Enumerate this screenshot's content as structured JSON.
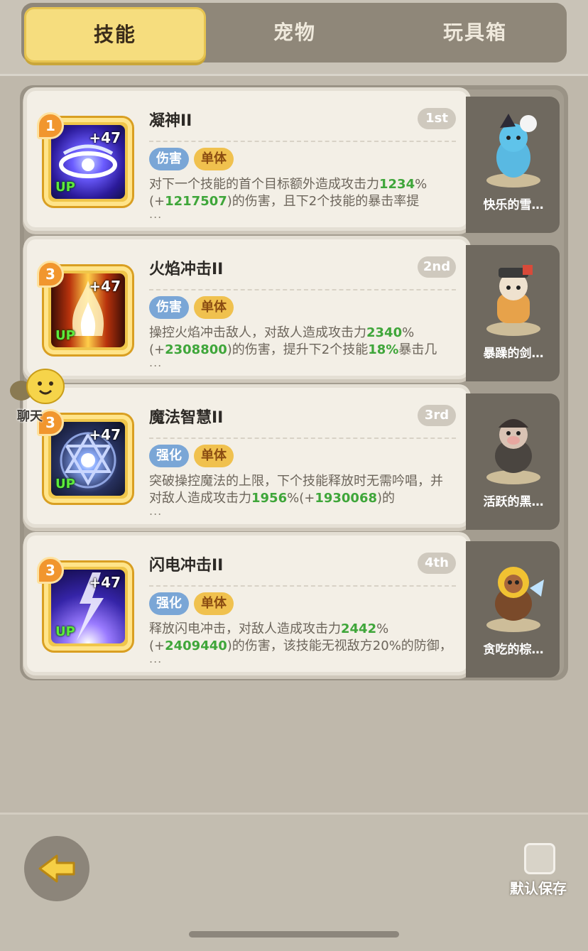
{
  "tabs": [
    {
      "label": "技能",
      "active": true
    },
    {
      "label": "宠物",
      "active": false
    },
    {
      "label": "玩具箱",
      "active": false
    }
  ],
  "skills": [
    {
      "level": "1",
      "plus": "+47",
      "up": "UP",
      "name": "凝神II",
      "rank": "1st",
      "tags": [
        "伤害",
        "单体"
      ],
      "desc_parts": [
        "对下一个技能的首个目标额外造成攻击力",
        "1234",
        "%(+",
        "1217507",
        ")的伤害，且下2个技能的暴击率提"
      ],
      "ellipsis": "...",
      "pet": "快乐的雪…"
    },
    {
      "level": "3",
      "plus": "+47",
      "up": "UP",
      "name": "火焰冲击II",
      "rank": "2nd",
      "tags": [
        "伤害",
        "单体"
      ],
      "desc_parts": [
        "操控火焰冲击敌人，对敌人造成攻击力",
        "2340",
        "%(+",
        "2308800",
        ")的伤害，提升下2个技能",
        "18%",
        "暴击几"
      ],
      "ellipsis": "...",
      "pet": "暴躁的剑…"
    },
    {
      "level": "3",
      "plus": "+47",
      "up": "UP",
      "name": "魔法智慧II",
      "rank": "3rd",
      "tags": [
        "强化",
        "单体"
      ],
      "desc_parts": [
        "突破操控魔法的上限，下个技能释放时无需吟唱，并对敌人造成攻击力",
        "1956",
        "%(+",
        "1930068",
        ")的"
      ],
      "ellipsis": "...",
      "pet": "活跃的黑…"
    },
    {
      "level": "3",
      "plus": "+47",
      "up": "UP",
      "name": "闪电冲击II",
      "rank": "4th",
      "tags": [
        "强化",
        "单体"
      ],
      "desc_parts": [
        "释放闪电冲击，对敌人造成攻击力",
        "2442",
        "%(+",
        "2409440",
        ")的伤害，该技能无视敌方20%的防御，"
      ],
      "ellipsis": "...",
      "pet": "贪吃的棕…"
    }
  ],
  "chat": {
    "label": "聊天"
  },
  "bottom": {
    "save_label": "默认保存"
  }
}
